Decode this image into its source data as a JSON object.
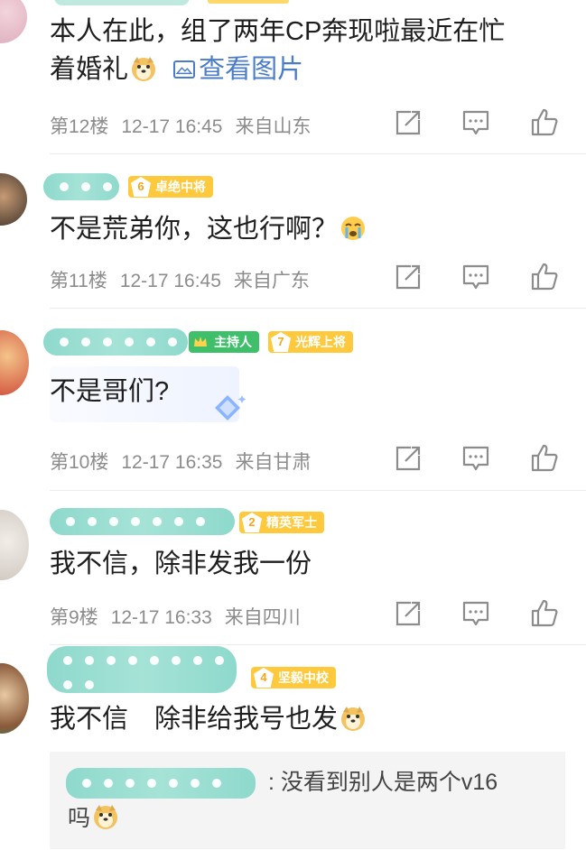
{
  "posts": [
    {
      "content_line1": "本人在此，组了两年CP奔现啦最近在忙",
      "content_line2": "着婚礼",
      "image_link": "查看图片",
      "floor": "第12楼",
      "time": "12-17 16:45",
      "location": "来自山东"
    },
    {
      "badge_level": "6",
      "badge_title": "卓绝中将",
      "content": "不是荒弟你，这也行啊？",
      "floor": "第11楼",
      "time": "12-17 16:45",
      "location": "来自广东"
    },
    {
      "host_badge": "主持人",
      "badge_level": "7",
      "badge_title": "光辉上将",
      "content": "不是哥们?",
      "floor": "第10楼",
      "time": "12-17 16:35",
      "location": "来自甘肃"
    },
    {
      "badge_level": "2",
      "badge_title": "精英军士",
      "content": "我不信，除非发我一份",
      "floor": "第9楼",
      "time": "12-17 16:33",
      "location": "来自四川"
    },
    {
      "badge_level": "4",
      "badge_title": "坚毅中校",
      "content": "我不信　除非给我号也发",
      "reply_text": ": 没看到别人是两个v16",
      "reply_line2": "吗"
    }
  ],
  "icons": {
    "share": "share-icon",
    "comment": "comment-icon",
    "like": "like-icon"
  },
  "colors": {
    "redaction": "#8ed9cc",
    "badge": "#ffc93d",
    "host_badge": "#3fbf6a",
    "link": "#4a7cc7",
    "meta_text": "#8c8c8c"
  }
}
